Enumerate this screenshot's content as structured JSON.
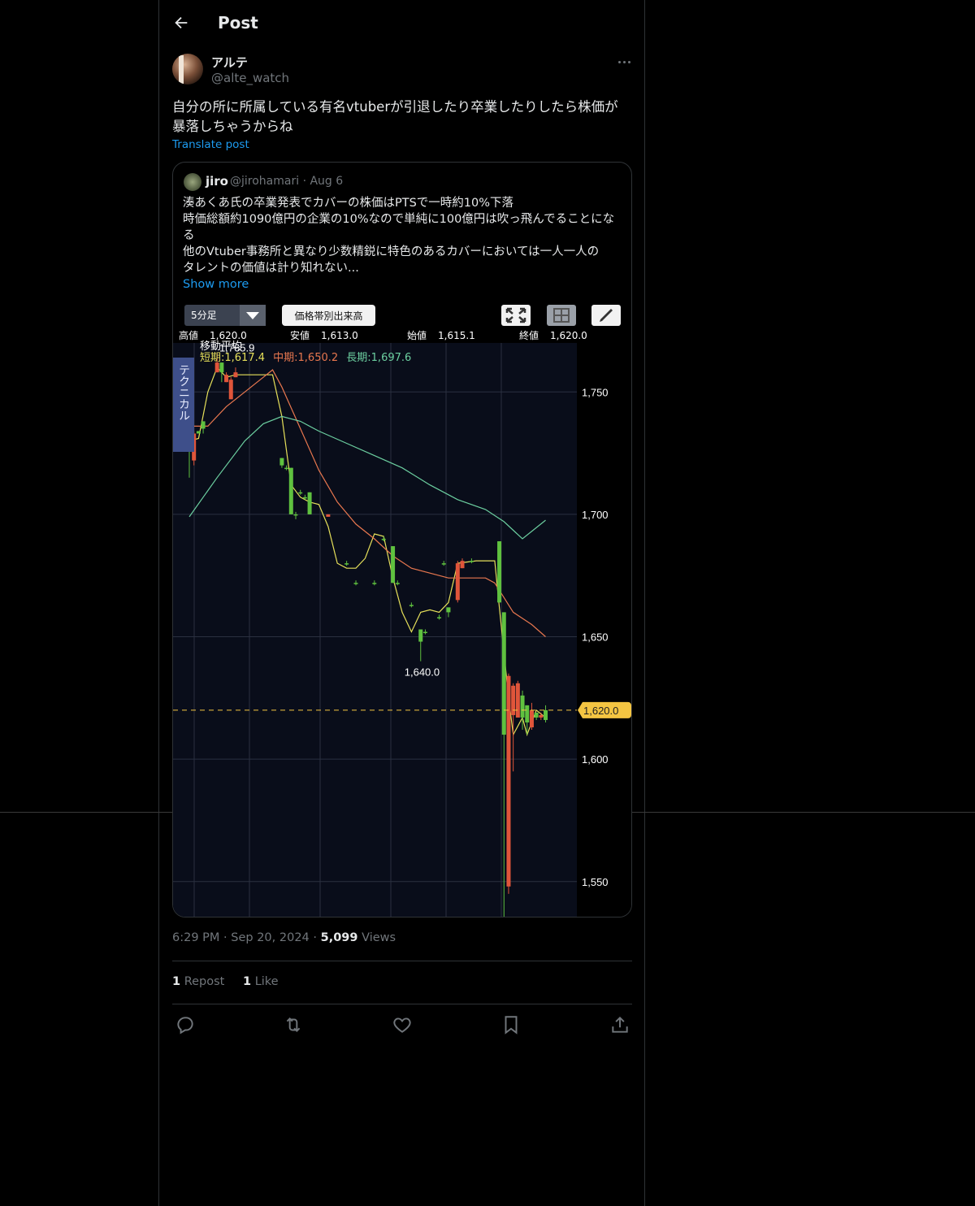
{
  "header": {
    "title": "Post"
  },
  "post": {
    "author_name": "アルテ",
    "author_handle": "@alte_watch",
    "text_line1": "自分の所に所属している有名vtuberが引退したり卒業したりしたら株価が",
    "text_line2": "暴落しちゃうからね",
    "translate_label": "Translate post",
    "time": "6:29 PM",
    "date": "Sep 20, 2024",
    "views_count": "5,099",
    "views_label": "Views",
    "repost_count": "1",
    "repost_label": "Repost",
    "like_count": "1",
    "like_label": "Like"
  },
  "quote": {
    "author_name": "jiro",
    "author_handle": "@jirohamari",
    "date": "Aug 6",
    "lines": [
      "湊あくあ氏の卒業発表でカバーの株価はPTSで一時約10%下落",
      "時価総額約1090億円の企業の10%なので単純に100億円は吹っ飛んでることにな",
      "る",
      "他のVtuber事務所と異なり少数精鋭に特色のあるカバーにおいては一人一人の",
      "タレントの価値は計り知れない..."
    ],
    "show_more": "Show more"
  },
  "chart_ui": {
    "interval_label": "5分足",
    "volume_button": "価格帯別出来高",
    "side_tab": "テクニカル",
    "stats": {
      "high_label": "高値",
      "high_value": "1,620.0",
      "low_label": "安値",
      "low_value": "1,613.0",
      "open_label": "始値",
      "open_value": "1,615.1",
      "close_label": "終値",
      "close_value": "1,620.0"
    },
    "ma_title": "移動平均",
    "ma_short": "短期:1,617.4",
    "ma_mid": "中期:1,650.2",
    "ma_long": "長期:1,697.6",
    "colors": {
      "up": "#5fc13f",
      "down": "#e0553a",
      "short": "#e6e05a",
      "mid": "#e8774f",
      "long": "#6ccfa0",
      "last": "#f4c542"
    }
  },
  "chart_data": {
    "type": "candlestick",
    "ylim": [
      1535,
      1770
    ],
    "yticks": [
      1750,
      1700,
      1650,
      1600,
      1550
    ],
    "ytick_labels": [
      "1,750",
      "1,700",
      "1,650",
      "1,600",
      "1,550"
    ],
    "last_price": 1620.0,
    "last_price_label": "1,620.0",
    "annotations": [
      {
        "label": "1,765.9",
        "x": 10,
        "y": 1765.9
      },
      {
        "label": "1,640.0",
        "x": 50,
        "y": 1640.0
      }
    ],
    "candles": [
      {
        "x": 0,
        "o": 1728,
        "h": 1729,
        "l": 1715,
        "c": 1729
      },
      {
        "x": 1,
        "o": 1733,
        "h": 1734,
        "l": 1720,
        "c": 1722
      },
      {
        "x": 2,
        "o": 1733,
        "h": 1734,
        "l": 1733,
        "c": 1734
      },
      {
        "x": 3,
        "o": 1735,
        "h": 1738,
        "l": 1733,
        "c": 1738
      },
      {
        "x": 6,
        "o": 1762,
        "h": 1765.9,
        "l": 1758,
        "c": 1758
      },
      {
        "x": 7,
        "o": 1758,
        "h": 1762,
        "l": 1754,
        "c": 1762
      },
      {
        "x": 8,
        "o": 1757,
        "h": 1758,
        "l": 1754,
        "c": 1754
      },
      {
        "x": 9,
        "o": 1755,
        "h": 1756,
        "l": 1747,
        "c": 1747
      },
      {
        "x": 10,
        "o": 1758,
        "h": 1760,
        "l": 1756,
        "c": 1756
      },
      {
        "x": 20,
        "o": 1720,
        "h": 1723,
        "l": 1719,
        "c": 1723
      },
      {
        "x": 21,
        "o": 1719,
        "h": 1720,
        "l": 1718,
        "c": 1719
      },
      {
        "x": 22,
        "o": 1700,
        "h": 1719,
        "l": 1700,
        "c": 1719
      },
      {
        "x": 23,
        "o": 1700,
        "h": 1701,
        "l": 1698,
        "c": 1700
      },
      {
        "x": 24,
        "o": 1709,
        "h": 1710,
        "l": 1708,
        "c": 1709
      },
      {
        "x": 25,
        "o": 1707,
        "h": 1708,
        "l": 1706,
        "c": 1707
      },
      {
        "x": 26,
        "o": 1700,
        "h": 1709,
        "l": 1700,
        "c": 1709
      },
      {
        "x": 30,
        "o": 1700,
        "h": 1700,
        "l": 1699,
        "c": 1699
      },
      {
        "x": 34,
        "o": 1680,
        "h": 1681,
        "l": 1679,
        "c": 1680
      },
      {
        "x": 36,
        "o": 1672,
        "h": 1673,
        "l": 1671,
        "c": 1672
      },
      {
        "x": 40,
        "o": 1672,
        "h": 1673,
        "l": 1671,
        "c": 1672
      },
      {
        "x": 42,
        "o": 1690,
        "h": 1691,
        "l": 1689,
        "c": 1690
      },
      {
        "x": 44,
        "o": 1672,
        "h": 1687,
        "l": 1672,
        "c": 1687
      },
      {
        "x": 45,
        "o": 1672,
        "h": 1673,
        "l": 1671,
        "c": 1672
      },
      {
        "x": 48,
        "o": 1663,
        "h": 1664,
        "l": 1662,
        "c": 1663
      },
      {
        "x": 50,
        "o": 1648,
        "h": 1653,
        "l": 1640,
        "c": 1653
      },
      {
        "x": 51,
        "o": 1652,
        "h": 1653,
        "l": 1651,
        "c": 1652
      },
      {
        "x": 54,
        "o": 1658,
        "h": 1659,
        "l": 1657,
        "c": 1658
      },
      {
        "x": 55,
        "o": 1680,
        "h": 1681,
        "l": 1679,
        "c": 1680
      },
      {
        "x": 56,
        "o": 1660,
        "h": 1662,
        "l": 1658,
        "c": 1662
      },
      {
        "x": 58,
        "o": 1680,
        "h": 1681,
        "l": 1664,
        "c": 1665
      },
      {
        "x": 59,
        "o": 1681,
        "h": 1682,
        "l": 1678,
        "c": 1678
      },
      {
        "x": 61,
        "o": 1681,
        "h": 1682,
        "l": 1680,
        "c": 1681
      },
      {
        "x": 67,
        "o": 1664,
        "h": 1689,
        "l": 1664,
        "c": 1689
      },
      {
        "x": 68,
        "o": 1610,
        "h": 1660,
        "l": 1530,
        "c": 1660
      },
      {
        "x": 69,
        "o": 1634,
        "h": 1635,
        "l": 1545,
        "c": 1548
      },
      {
        "x": 70,
        "o": 1630,
        "h": 1631,
        "l": 1595,
        "c": 1618
      },
      {
        "x": 71,
        "o": 1631,
        "h": 1632,
        "l": 1617,
        "c": 1617
      },
      {
        "x": 72,
        "o": 1617,
        "h": 1628,
        "l": 1612,
        "c": 1626
      },
      {
        "x": 73,
        "o": 1615,
        "h": 1622,
        "l": 1610,
        "c": 1622
      },
      {
        "x": 74,
        "o": 1620,
        "h": 1623,
        "l": 1612,
        "c": 1613
      },
      {
        "x": 75,
        "o": 1617,
        "h": 1619,
        "l": 1616,
        "c": 1619
      },
      {
        "x": 76,
        "o": 1618,
        "h": 1619,
        "l": 1616,
        "c": 1617
      },
      {
        "x": 77,
        "o": 1616,
        "h": 1622,
        "l": 1615,
        "c": 1620
      }
    ],
    "series": [
      {
        "name": "短期",
        "color": "#e6e05a",
        "points": [
          [
            0,
            1730
          ],
          [
            2,
            1731
          ],
          [
            4,
            1750
          ],
          [
            6,
            1760
          ],
          [
            8,
            1756
          ],
          [
            10,
            1757
          ],
          [
            16,
            1757
          ],
          [
            18,
            1757
          ],
          [
            20,
            1740
          ],
          [
            22,
            1712
          ],
          [
            24,
            1707
          ],
          [
            26,
            1705
          ],
          [
            28,
            1704
          ],
          [
            30,
            1695
          ],
          [
            32,
            1680
          ],
          [
            34,
            1678
          ],
          [
            36,
            1678
          ],
          [
            38,
            1682
          ],
          [
            40,
            1692
          ],
          [
            42,
            1691
          ],
          [
            44,
            1674
          ],
          [
            46,
            1660
          ],
          [
            48,
            1652
          ],
          [
            50,
            1660
          ],
          [
            52,
            1661
          ],
          [
            54,
            1660
          ],
          [
            56,
            1664
          ],
          [
            58,
            1680
          ],
          [
            62,
            1681
          ],
          [
            66,
            1681
          ],
          [
            67,
            1662
          ],
          [
            69,
            1625
          ],
          [
            70,
            1610
          ],
          [
            72,
            1617
          ],
          [
            73,
            1610
          ],
          [
            75,
            1620
          ],
          [
            77,
            1617
          ]
        ]
      },
      {
        "name": "中期",
        "color": "#e8774f",
        "points": [
          [
            0,
            1736
          ],
          [
            4,
            1736
          ],
          [
            8,
            1744
          ],
          [
            12,
            1750
          ],
          [
            16,
            1756
          ],
          [
            18,
            1759
          ],
          [
            20,
            1752
          ],
          [
            24,
            1735
          ],
          [
            28,
            1718
          ],
          [
            32,
            1705
          ],
          [
            36,
            1696
          ],
          [
            40,
            1690
          ],
          [
            44,
            1683
          ],
          [
            48,
            1678
          ],
          [
            52,
            1676
          ],
          [
            56,
            1674
          ],
          [
            60,
            1674
          ],
          [
            64,
            1674
          ],
          [
            66,
            1672
          ],
          [
            70,
            1660
          ],
          [
            74,
            1655
          ],
          [
            77,
            1650
          ]
        ]
      },
      {
        "name": "長期",
        "color": "#6ccfa0",
        "points": [
          [
            0,
            1699
          ],
          [
            6,
            1715
          ],
          [
            12,
            1730
          ],
          [
            16,
            1737
          ],
          [
            20,
            1740
          ],
          [
            24,
            1738
          ],
          [
            28,
            1734
          ],
          [
            34,
            1729
          ],
          [
            40,
            1724
          ],
          [
            46,
            1719
          ],
          [
            52,
            1712
          ],
          [
            58,
            1706
          ],
          [
            64,
            1702
          ],
          [
            68,
            1697
          ],
          [
            72,
            1690
          ],
          [
            77,
            1697.6
          ]
        ]
      }
    ]
  }
}
